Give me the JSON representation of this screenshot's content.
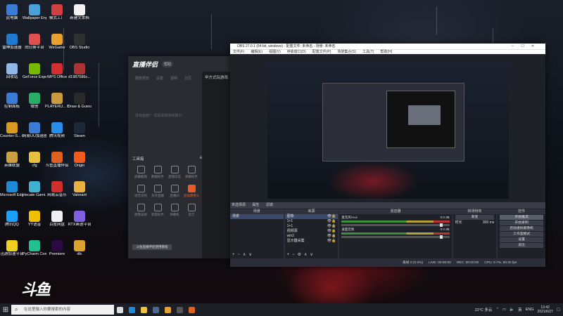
{
  "desktop": {
    "icons": [
      {
        "label": "此电脑",
        "color": "#3a7bd5"
      },
      {
        "label": "Wallpaper Engine:...",
        "color": "#4aa0d8"
      },
      {
        "label": "模式工厂",
        "color": "#d04040"
      },
      {
        "label": "新建文本档",
        "color": "#f2f2f2"
      },
      {
        "label": "雷神加速器",
        "color": "#1e7bd1"
      },
      {
        "label": "向日葵平台",
        "color": "#e05050"
      },
      {
        "label": "WeGame",
        "color": "#e8a030"
      },
      {
        "label": "OBS Studio",
        "color": "#303030"
      },
      {
        "label": "回收站",
        "color": "#8fb8e8"
      },
      {
        "label": "GeForce Experience",
        "color": "#76b900"
      },
      {
        "label": "WPS Office",
        "color": "#d23030"
      },
      {
        "label": "d1987586c...",
        "color": "#a33"
      },
      {
        "label": "控制面板",
        "color": "#3a7bd5"
      },
      {
        "label": "微信",
        "color": "#2aae67"
      },
      {
        "label": "PLAYERU... BATTLEGR...",
        "color": "#c89b3c"
      },
      {
        "label": "Draw & Guess",
        "color": "#2a2a2a"
      },
      {
        "label": "Counter-S... Global Off...",
        "color": "#d89a20"
      },
      {
        "label": "网易UU加速器",
        "color": "#3a7bd5"
      },
      {
        "label": "腾讯视频",
        "color": "#2a8ee8"
      },
      {
        "label": "Steam",
        "color": "#1b2838"
      },
      {
        "label": "英雄联盟",
        "color": "#c8a040"
      },
      {
        "label": "cfg",
        "color": "#e8c040"
      },
      {
        "label": "斗鱼直播伴侣",
        "color": "#e06020"
      },
      {
        "label": "Origin",
        "color": "#f05a1a"
      },
      {
        "label": "Microsoft Edge",
        "color": "#1d8ad8"
      },
      {
        "label": "Hecate Gami...",
        "color": "#40b0d0"
      },
      {
        "label": "网易云音乐",
        "color": "#d0302a"
      },
      {
        "label": "Valorant",
        "color": "#e8b040"
      },
      {
        "label": "腾讯QQ",
        "color": "#1aa0ff"
      },
      {
        "label": "YY语音",
        "color": "#f0c000"
      },
      {
        "label": "百度网盘",
        "color": "#f0f0f0"
      },
      {
        "label": "RTX画语平台",
        "color": "#8060e0"
      },
      {
        "label": "迅游加速平台",
        "color": "#f0d020"
      },
      {
        "label": "PyCharm Communit...",
        "color": "#22c090"
      },
      {
        "label": "Premiere",
        "color": "#2a0a40"
      },
      {
        "label": "dlc",
        "color": "#e0a030"
      }
    ],
    "watermark": "斗鱼"
  },
  "douyu": {
    "logo": "直播伴侣",
    "help_badge": "帮助",
    "tabs": [
      "图像预览",
      "设置",
      "说明",
      "分区"
    ],
    "notice": "没有画面？ 试试添加游戏窗口·",
    "right_title": "甲方式玩游戏",
    "tools_title": "工具箱",
    "tools": [
      {
        "label": "屏幕截图"
      },
      {
        "label": "数据助手"
      },
      {
        "label": "直播日志"
      },
      {
        "label": "弹幕助手"
      },
      {
        "label": "语音识别"
      },
      {
        "label": "多开直播"
      },
      {
        "label": "直播间"
      },
      {
        "label": "虚拟摄像头"
      },
      {
        "label": "图像美颜"
      },
      {
        "label": "智能助手"
      },
      {
        "label": "弹幕机"
      },
      {
        "label": "其它"
      }
    ],
    "footer_button": "斗鱼直播伴侣使用教程"
  },
  "obs": {
    "title": "OBS 27.0.1 (64-bit, windows) - 配置文件: 未命名 - 场景: 未命名",
    "menu": [
      "文件(F)",
      "编辑(E)",
      "视图(V)",
      "停靠窗口(D)",
      "配置文件(P)",
      "场景集合(S)",
      "工具(T)",
      "帮助(H)"
    ],
    "preview_status": [
      "未选择源",
      "属性",
      "滤镜"
    ],
    "scenes_title": "场景",
    "scenes": [
      "场景"
    ],
    "sources_title": "来源",
    "sources": [
      {
        "name": "图像",
        "selected": true
      },
      {
        "name": "1+1",
        "selected": false
      },
      {
        "name": "1+1",
        "selected": false
      },
      {
        "name": "视频源",
        "selected": false
      },
      {
        "name": "win2",
        "selected": false
      },
      {
        "name": "显示器采集",
        "selected": false
      }
    ],
    "mixer_title": "混音器",
    "mixer": [
      {
        "name": "麦克风/Aux",
        "db": "0.0 dB"
      },
      {
        "name": "桌面音频",
        "db": "0.0 dB"
      }
    ],
    "transitions_title": "转场特效",
    "transition_value": "渐变",
    "duration_label": "时长",
    "duration_value": "300 ms",
    "controls_title": "控件",
    "controls": [
      "开始推流",
      "开始录制",
      "启动虚拟摄像机",
      "工作室模式",
      "设置",
      "退出"
    ],
    "statusbar": [
      "丢帧 0 (0.0%)",
      "LIVE: 00:00:00",
      "REC: 00:00:00",
      "CPU: 0.7%, 60.00 fps"
    ]
  },
  "taskbar": {
    "search_placeholder": "在这里输入你要搜索的内容",
    "apps": [
      {
        "name": "task-view",
        "color": "#ddd"
      },
      {
        "name": "edge",
        "color": "#1d8ad8"
      },
      {
        "name": "explorer",
        "color": "#f0c040"
      },
      {
        "name": "steam",
        "color": "#4a6a90"
      },
      {
        "name": "wegame",
        "color": "#e8a030"
      },
      {
        "name": "obs",
        "color": "#555"
      },
      {
        "name": "douyu",
        "color": "#e06020"
      }
    ],
    "weather": "22°C 多云",
    "ime": "英",
    "lang": "ENG",
    "time": "13:42",
    "date": "2021/6/27"
  }
}
